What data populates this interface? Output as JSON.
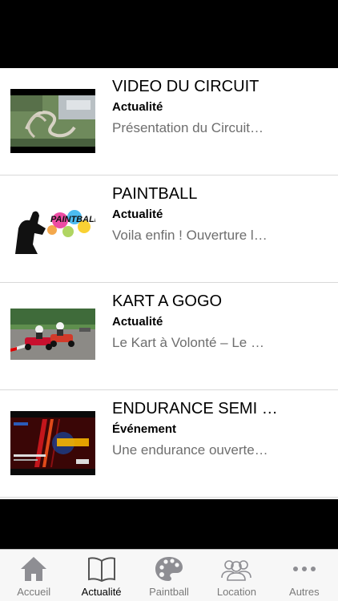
{
  "articles": [
    {
      "title": "VIDEO DU CIRCUIT",
      "category": "Actualité",
      "excerpt": "Présentation du Circuit…",
      "thumb_icon": "circuit-aerial-thumbnail"
    },
    {
      "title": "PAINTBALL",
      "category": "Actualité",
      "excerpt": "Voila enfin ! Ouverture l…",
      "thumb_icon": "paintball-logo-thumbnail",
      "thumb_text": "PAINTBALL OUEST"
    },
    {
      "title": "KART A GOGO",
      "category": "Actualité",
      "excerpt": "Le Kart à Volonté – Le …",
      "thumb_icon": "karting-photo-thumbnail"
    },
    {
      "title": "ENDURANCE SEMI …",
      "category": "Événement",
      "excerpt": "Une endurance ouverte…",
      "thumb_icon": "endurance-poster-thumbnail"
    }
  ],
  "tabs": [
    {
      "label": "Accueil",
      "icon": "home-icon",
      "active": false
    },
    {
      "label": "Actualité",
      "icon": "book-icon",
      "active": true
    },
    {
      "label": "Paintball",
      "icon": "palette-icon",
      "active": false
    },
    {
      "label": "Location",
      "icon": "group-icon",
      "active": false
    },
    {
      "label": "Autres",
      "icon": "more-icon",
      "active": false
    }
  ],
  "colors": {
    "tab_active": "#000000",
    "tab_inactive": "#7a7a7a",
    "icon_inactive": "#8e8e93",
    "icon_active": "#555555"
  }
}
